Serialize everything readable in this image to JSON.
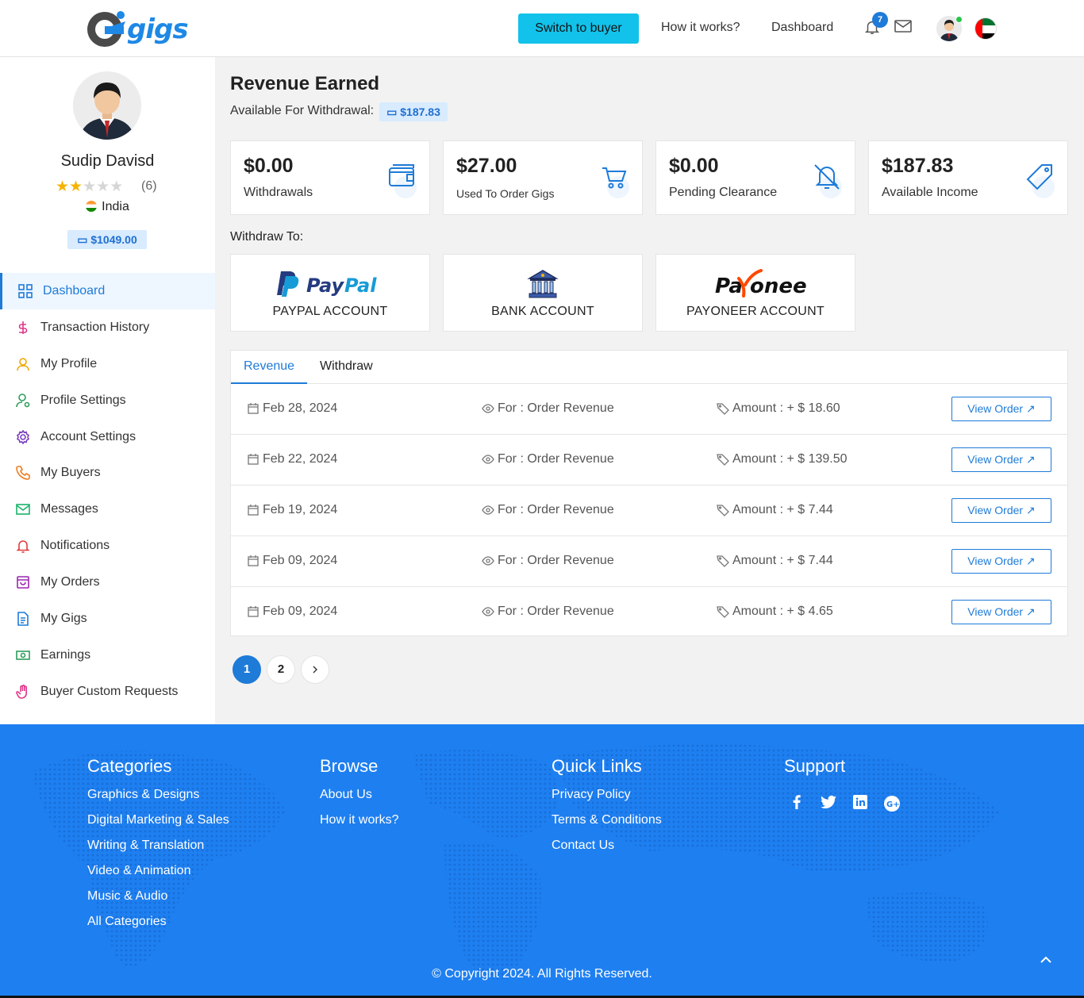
{
  "header": {
    "logo_text": "gigs",
    "switch_label": "Switch to buyer",
    "nav": [
      "How it works?",
      "Dashboard"
    ],
    "notification_count": "7"
  },
  "profile": {
    "name": "Sudip Davisd",
    "rating": 2,
    "rating_max": 5,
    "rating_count": "(6)",
    "country": "India",
    "balance": "$1049.00"
  },
  "sidebar": {
    "items": [
      {
        "label": "Dashboard",
        "icon": "grid-icon",
        "color": "#1e7bd8",
        "active": true
      },
      {
        "label": "Transaction History",
        "icon": "dollar-icon",
        "color": "#e0368a"
      },
      {
        "label": "My Profile",
        "icon": "user-icon",
        "color": "#f0a500"
      },
      {
        "label": "Profile Settings",
        "icon": "user-settings-icon",
        "color": "#2e9d5b"
      },
      {
        "label": "Account Settings",
        "icon": "gear-icon",
        "color": "#7b3fbf"
      },
      {
        "label": "My Buyers",
        "icon": "phone-icon",
        "color": "#ef7d22"
      },
      {
        "label": "Messages",
        "icon": "mail-icon",
        "color": "#19b36b"
      },
      {
        "label": "Notifications",
        "icon": "bell-icon",
        "color": "#e23d3d"
      },
      {
        "label": "My Orders",
        "icon": "bag-icon",
        "color": "#9c27b0"
      },
      {
        "label": "My Gigs",
        "icon": "document-icon",
        "color": "#1e7bd8"
      },
      {
        "label": "Earnings",
        "icon": "money-icon",
        "color": "#2e9d5b"
      },
      {
        "label": "Buyer Custom Requests",
        "icon": "hand-icon",
        "color": "#e0368a"
      }
    ]
  },
  "main": {
    "title": "Revenue Earned",
    "available_label": "Available For Withdrawal:",
    "available_value": "$187.83",
    "stats": [
      {
        "value": "$0.00",
        "label": "Withdrawals",
        "icon": "wallet-icon"
      },
      {
        "value": "$27.00",
        "label": "Used To Order Gigs",
        "icon": "cart-icon"
      },
      {
        "value": "$0.00",
        "label": "Pending Clearance",
        "icon": "bell-off-icon"
      },
      {
        "value": "$187.83",
        "label": "Available Income",
        "icon": "tag-icon"
      }
    ],
    "withdraw_to_label": "Withdraw To:",
    "methods": [
      {
        "label": "PAYPAL ACCOUNT",
        "logo_text": "PayPal"
      },
      {
        "label": "BANK ACCOUNT"
      },
      {
        "label": "PAYONEER ACCOUNT",
        "logo_text": "Payoneer"
      }
    ],
    "tabs": [
      "Revenue",
      "Withdraw"
    ],
    "rows": [
      {
        "date": "Feb 28, 2024",
        "for": "For : Order Revenue",
        "amount": "Amount : + $ 18.60",
        "button": "View Order"
      },
      {
        "date": "Feb 22, 2024",
        "for": "For : Order Revenue",
        "amount": "Amount : + $ 139.50",
        "button": "View Order"
      },
      {
        "date": "Feb 19, 2024",
        "for": "For : Order Revenue",
        "amount": "Amount : + $ 7.44",
        "button": "View Order"
      },
      {
        "date": "Feb 09, 2024",
        "for": "For : Order Revenue",
        "amount": "Amount : + $ 7.44",
        "button": "View Order"
      },
      {
        "date": "Feb 09, 2024",
        "for": "For : Order Revenue",
        "amount": "Amount : + $ 4.65",
        "button": "View Order"
      }
    ],
    "pagination": [
      "1",
      "2"
    ]
  },
  "footer": {
    "columns": [
      {
        "title": "Categories",
        "links": [
          "Graphics & Designs",
          "Digital Marketing & Sales",
          "Writing & Translation",
          "Video & Animation",
          "Music & Audio",
          "All Categories"
        ]
      },
      {
        "title": "Browse",
        "links": [
          "About Us",
          "How it works?"
        ]
      },
      {
        "title": "Quick Links",
        "links": [
          "Privacy Policy",
          "Terms & Conditions",
          "Contact Us"
        ]
      },
      {
        "title": "Support",
        "links": []
      }
    ],
    "social": [
      "facebook-icon",
      "twitter-icon",
      "linkedin-icon",
      "google-plus-icon"
    ],
    "copyright": "© Copyright 2024. All Rights Reserved."
  },
  "colors": {
    "primary": "#1e7bd8",
    "cyan": "#12c2ea",
    "footer": "#1e7ff0"
  }
}
